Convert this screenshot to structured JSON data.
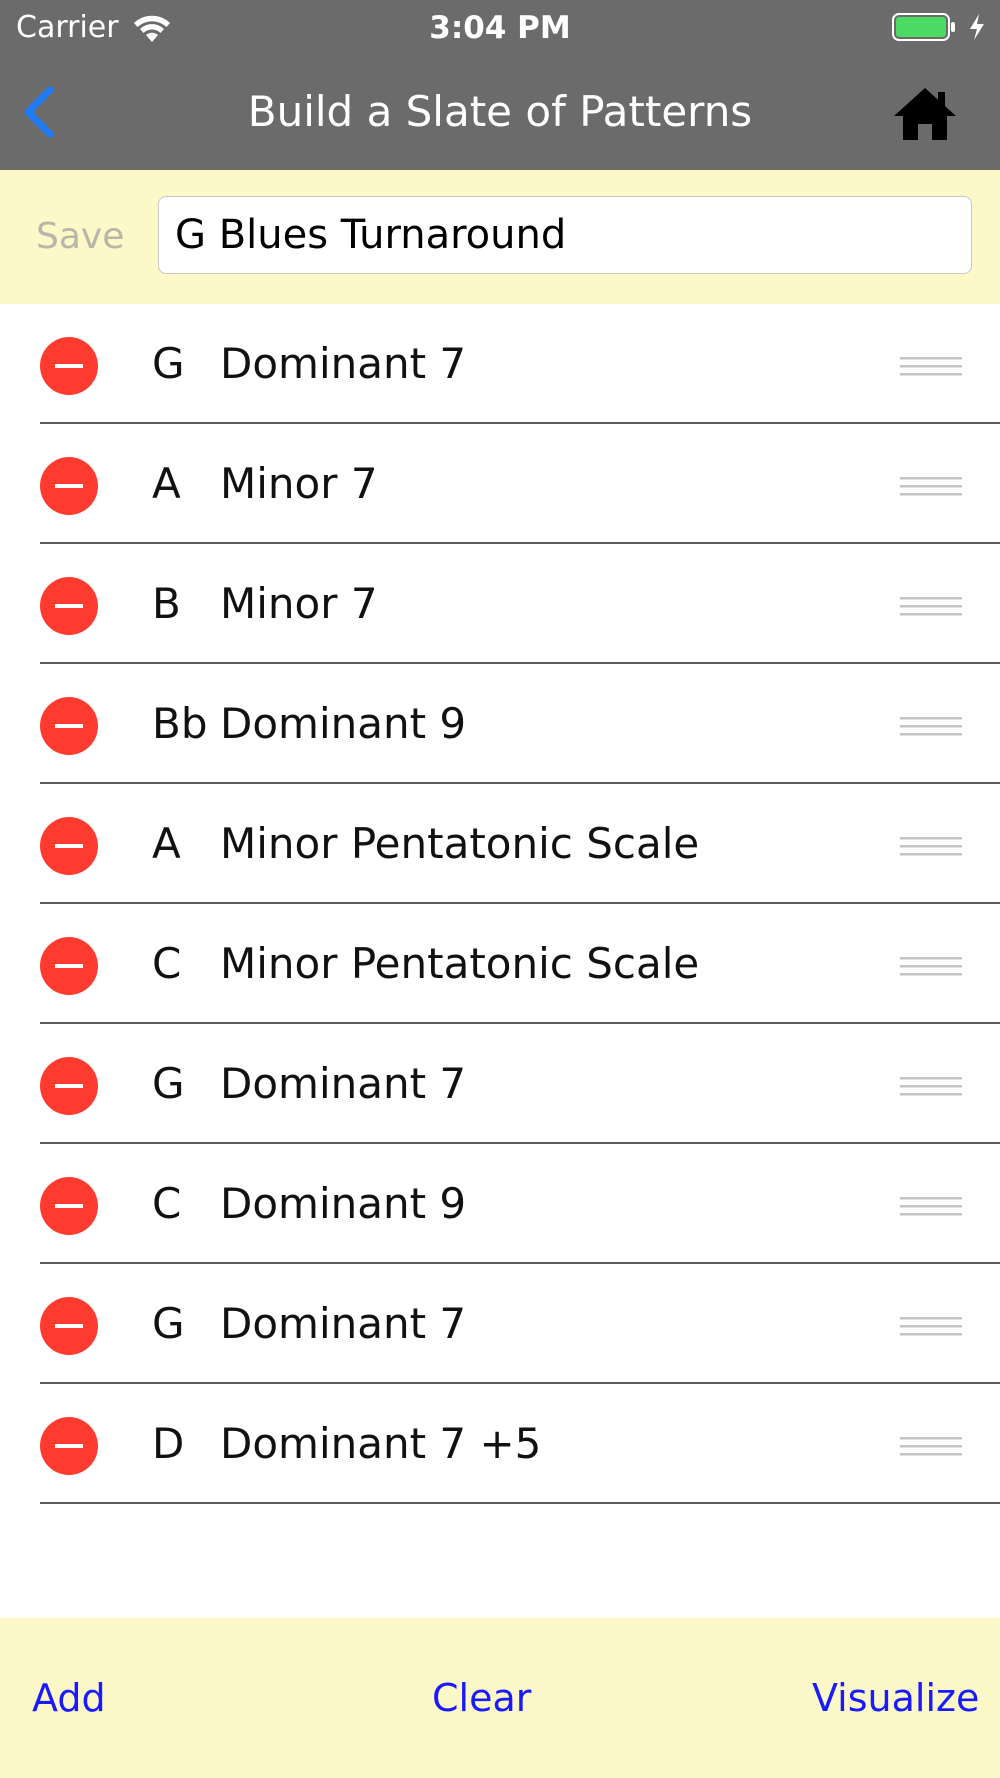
{
  "status_bar": {
    "carrier": "Carrier",
    "time": "3:04 PM"
  },
  "nav": {
    "title": "Build a Slate of Patterns",
    "back_icon": "chevron-left-icon",
    "home_icon": "home-icon"
  },
  "save_area": {
    "save_label": "Save",
    "name_value": "G Blues Turnaround"
  },
  "patterns": [
    {
      "root": "G",
      "name": "Dominant 7"
    },
    {
      "root": "A",
      "name": "Minor 7"
    },
    {
      "root": "B",
      "name": "Minor 7"
    },
    {
      "root": "Bb",
      "name": "Dominant 9"
    },
    {
      "root": "A",
      "name": "Minor Pentatonic Scale"
    },
    {
      "root": "C",
      "name": "Minor Pentatonic Scale"
    },
    {
      "root": "G",
      "name": "Dominant 7"
    },
    {
      "root": "C",
      "name": "Dominant 9"
    },
    {
      "root": "G",
      "name": "Dominant 7"
    },
    {
      "root": "D",
      "name": "Dominant 7 +5"
    }
  ],
  "toolbar": {
    "add_label": "Add",
    "clear_label": "Clear",
    "visualize_label": "Visualize"
  },
  "colors": {
    "nav_background": "#6b6b6b",
    "panel_background": "#fcf8c8",
    "accent_blue": "#1a1aff",
    "back_blue": "#1e7bf5",
    "delete_red": "#ff3b30",
    "battery_green": "#4cd964"
  }
}
